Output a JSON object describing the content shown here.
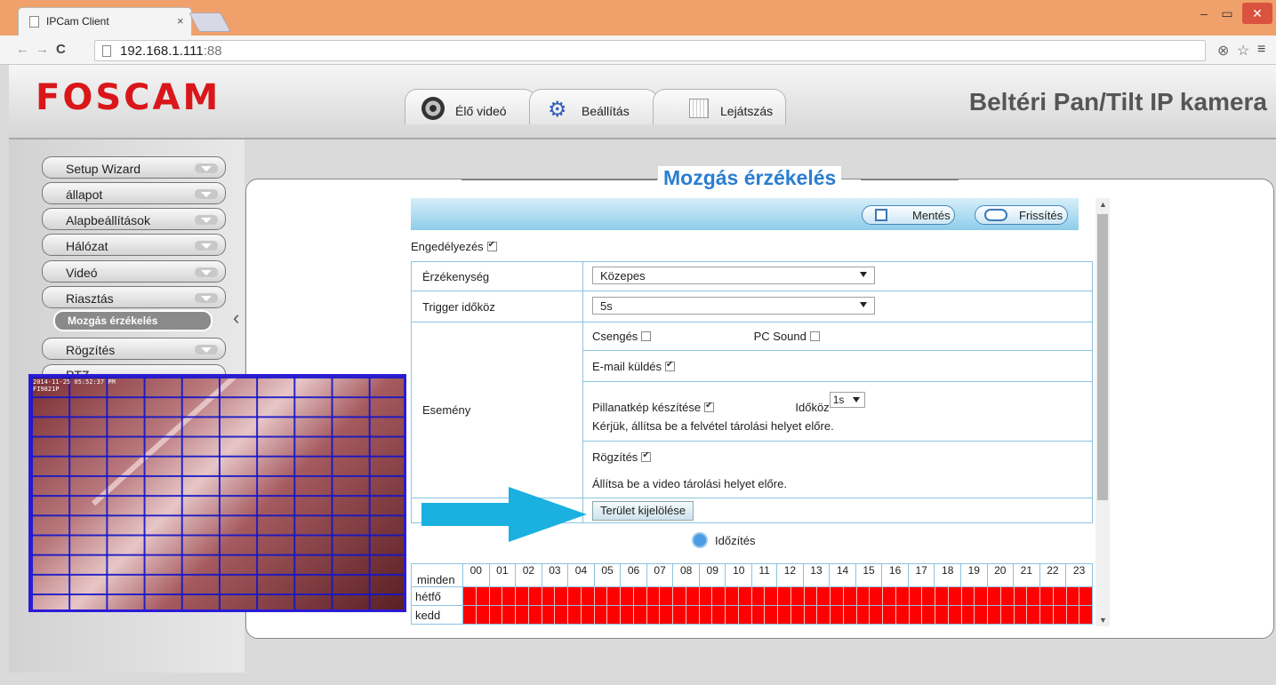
{
  "browser": {
    "tab_title": "IPCam Client",
    "tab_close": "×",
    "url_host": "192.168.1.111",
    "url_port": ":88",
    "win_min": "‒",
    "win_max": "▭",
    "win_close": "✕",
    "back": "←",
    "forward": "→",
    "reload": "C",
    "icons": [
      "page-icon",
      "extension-icon",
      "star-icon",
      "menu-icon"
    ]
  },
  "header": {
    "logo": "FOSCAM",
    "camera_title": "Beltéri Pan/Tilt IP kamera",
    "tabs": [
      {
        "label": "Élő videó",
        "icon": "webcam-icon"
      },
      {
        "label": "Beállítás",
        "icon": "gear-icon"
      },
      {
        "label": "Lejátszás",
        "icon": "calendar-icon"
      }
    ]
  },
  "sidebar": {
    "items": [
      {
        "label": "Setup Wizard"
      },
      {
        "label": "állapot"
      },
      {
        "label": "Alapbeállítások"
      },
      {
        "label": "Hálózat"
      },
      {
        "label": "Videó"
      },
      {
        "label": "Riasztás"
      }
    ],
    "active_subitem": "Mozgás érzékelés",
    "after_items": [
      {
        "label": "Rögzítés"
      },
      {
        "label": "PTZ"
      }
    ]
  },
  "main": {
    "title": "Mozgás érzékelés",
    "save_label": "Mentés",
    "refresh_label": "Frissítés",
    "enable_label": "Engedélyezés",
    "enable_checked": true,
    "sensitivity_label": "Érzékenység",
    "sensitivity_value": "Közepes",
    "trigger_label": "Trigger időköz",
    "trigger_value": "5s",
    "event_label": "Esemény",
    "events": {
      "ring_label": "Csengés",
      "pc_sound_label": "PC Sound",
      "email_label": "E-mail küldés",
      "snapshot_label": "Pillanatkép készítése",
      "interval_label": "Időköz",
      "interval_value": "1s",
      "snapshot_note": "Kérjük, állítsa be a felvétel tárolási helyet előre.",
      "record_label": "Rögzítés",
      "record_note": "Állítsa be a video tárolási helyet előre."
    },
    "area_button_label": "Terület kijelölése",
    "schedule_label": "Időzítés",
    "schedule": {
      "all_label": "minden",
      "hours": [
        "00",
        "01",
        "02",
        "03",
        "04",
        "05",
        "06",
        "07",
        "08",
        "09",
        "10",
        "11",
        "12",
        "13",
        "14",
        "15",
        "16",
        "17",
        "18",
        "19",
        "20",
        "21",
        "22",
        "23"
      ],
      "days": [
        "hétfő",
        "kedd"
      ],
      "active_color": "#ff0000"
    }
  },
  "video": {
    "timestamp_line1": "2014-11-25 05:52:37 PM",
    "timestamp_line2": "FI9821P"
  },
  "colors": {
    "accent": "#2b7dd0",
    "logo_red": "#d9171a",
    "callout_arrow": "#1ab1e0",
    "grid_blue": "#2b1bd6"
  }
}
